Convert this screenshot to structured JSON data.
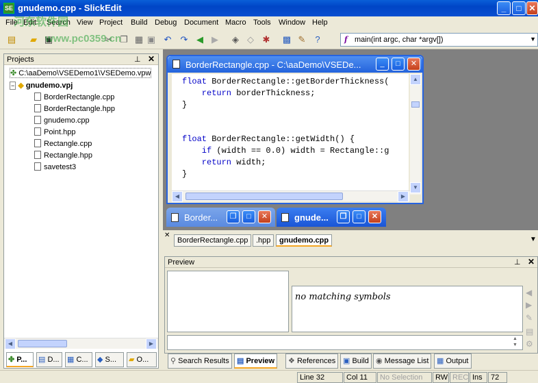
{
  "window": {
    "title": "gnudemo.cpp - SlickEdit",
    "app_icon": "SE"
  },
  "menu": [
    "File",
    "Edit",
    "Search",
    "View",
    "Project",
    "Build",
    "Debug",
    "Document",
    "Macro",
    "Tools",
    "Window",
    "Help"
  ],
  "toolbar": {
    "function_combo": "main(int argc, char *argv[])",
    "function_glyph": "f"
  },
  "projects": {
    "title": "Projects",
    "workspace": "C:\\aaDemo\\VSEDemo1\\VSEDemo.vpw",
    "project": "gnudemo.vpj",
    "files": [
      "BorderRectangle.cpp",
      "BorderRectangle.hpp",
      "gnudemo.cpp",
      "Point.hpp",
      "Rectangle.cpp",
      "Rectangle.hpp",
      "savetest3"
    ],
    "tabs": [
      "P...",
      "D...",
      "C...",
      "S...",
      "O..."
    ]
  },
  "editor": {
    "title": "BorderRectangle.cpp - C:\\aaDemo\\VSEDe...",
    "lines": [
      {
        "kw": "float",
        "rest": " BorderRectangle::getBorderThickness("
      },
      {
        "kw": "    return",
        "rest": " borderThickness;"
      },
      {
        "kw": "",
        "rest": "}"
      },
      {
        "kw": "",
        "rest": ""
      },
      {
        "kw": "",
        "rest": ""
      },
      {
        "kw": "float",
        "rest": " BorderRectangle::getWidth() {"
      },
      {
        "kw": "    if",
        "rest": " (width == 0.0) width = Rectangle::g"
      },
      {
        "kw": "    return",
        "rest": " width;"
      },
      {
        "kw": "",
        "rest": "}"
      }
    ]
  },
  "minimized": [
    "Border...",
    "gnude..."
  ],
  "file_tabs": [
    "BorderRectangle.cpp",
    ".hpp",
    "gnudemo.cpp"
  ],
  "preview": {
    "title": "Preview",
    "message": "no matching symbols"
  },
  "tool_tabs": [
    "Search Results",
    "Preview",
    "References",
    "Build",
    "Message List",
    "Output"
  ],
  "status": [
    "Line 32",
    "Col 11",
    "No Selection",
    "RW",
    "REC",
    "Ins",
    "72"
  ],
  "watermark": {
    "line1": "河东软件园",
    "line2": "www.pc0359.cn"
  }
}
